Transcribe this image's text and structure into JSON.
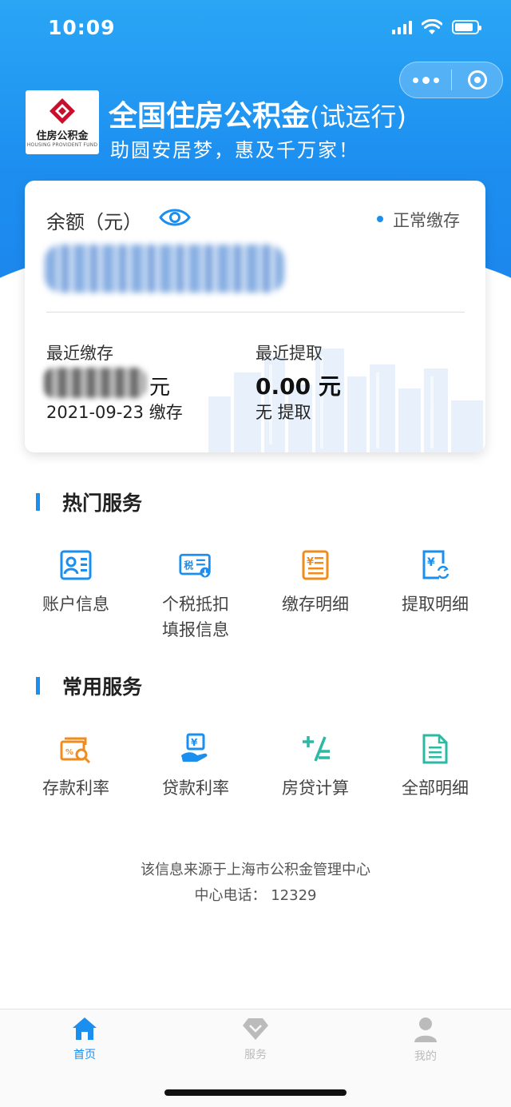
{
  "status_bar": {
    "time": "10:09",
    "battery_level": 0.85,
    "signal_bars": 4
  },
  "header": {
    "logo_cn": "住房公积金",
    "logo_en": "HOUSING PROVIDENT FUND",
    "title": "全国住房公积金",
    "title_suffix": "(试运行)",
    "slogan": "助圆安居梦，惠及千万家！"
  },
  "card": {
    "balance_label": "余额（元）",
    "status": "正常缴存",
    "recent_deposit_label": "最近缴存",
    "recent_deposit_unit": "元",
    "recent_deposit_date": "2021-09-23 缴存",
    "recent_withdraw_label": "最近提取",
    "recent_withdraw_amount": "0.00 元",
    "recent_withdraw_note": "无 提取"
  },
  "hot_services": {
    "title": "热门服务",
    "items": [
      {
        "label": "账户信息",
        "icon": "account-card-icon"
      },
      {
        "label": "个税抵扣",
        "label2": "填报信息",
        "icon": "tax-icon"
      },
      {
        "label": "缴存明细",
        "icon": "deposit-detail-icon"
      },
      {
        "label": "提取明细",
        "icon": "withdraw-detail-icon"
      }
    ]
  },
  "common_services": {
    "title": "常用服务",
    "items": [
      {
        "label": "存款利率",
        "icon": "deposit-rate-icon"
      },
      {
        "label": "贷款利率",
        "icon": "loan-rate-icon"
      },
      {
        "label": "房贷计算",
        "icon": "calculator-icon"
      },
      {
        "label": "全部明细",
        "icon": "all-details-icon"
      }
    ]
  },
  "footer": {
    "source": "该信息来源于上海市公积金管理中心",
    "phone": "中心电话： 12329"
  },
  "tabbar": {
    "items": [
      {
        "label": "首页",
        "icon": "home-icon",
        "active": true
      },
      {
        "label": "服务",
        "icon": "diamond-icon",
        "active": false
      },
      {
        "label": "我的",
        "icon": "user-icon",
        "active": false
      }
    ]
  },
  "colors": {
    "primary": "#1a8ff0",
    "orange": "#f08c1d",
    "teal": "#2bb9a4",
    "inactive": "#bbbbbb"
  }
}
